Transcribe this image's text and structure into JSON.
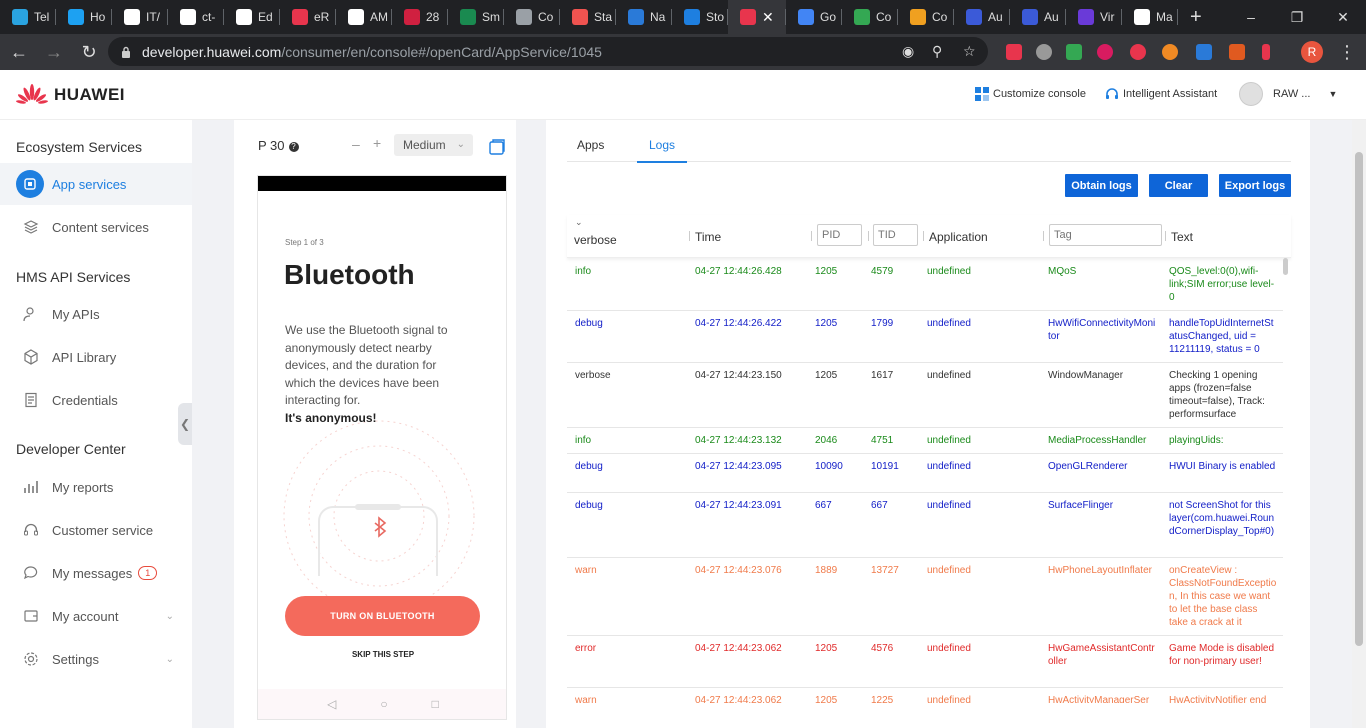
{
  "browser": {
    "tabs": [
      {
        "title": "Tel",
        "color": "#2aa3e0",
        "icon": "telegram-icon"
      },
      {
        "title": "Ho",
        "color": "#1da1f2",
        "icon": "twitter-icon"
      },
      {
        "title": "IT/",
        "color": "#ffffff",
        "icon": "github-icon"
      },
      {
        "title": "ct-",
        "color": "#ffffff",
        "icon": "github-icon"
      },
      {
        "title": "Ed",
        "color": "#ffffff",
        "icon": "github-icon"
      },
      {
        "title": "eR",
        "color": "#e8354d",
        "icon": "app-icon"
      },
      {
        "title": "AM",
        "color": "#ffffff",
        "icon": "globe-icon"
      },
      {
        "title": "28",
        "color": "#d02040",
        "icon": "app-icon"
      },
      {
        "title": "Sm",
        "color": "#1a8a50",
        "icon": "app-icon"
      },
      {
        "title": "Co",
        "color": "#9aa0a6",
        "icon": "globe-icon"
      },
      {
        "title": "Sta",
        "color": "#ef5350",
        "icon": "app-icon"
      },
      {
        "title": "Na",
        "color": "#2a7ad8",
        "icon": "code-icon"
      },
      {
        "title": "Sto",
        "color": "#1e7fe0",
        "icon": "app-icon"
      },
      {
        "title": "",
        "color": "#e8354d",
        "icon": "huawei-icon"
      },
      {
        "title": "Go",
        "color": "#4285f4",
        "icon": "translate-icon"
      },
      {
        "title": "Co",
        "color": "#34a853",
        "icon": "play-icon"
      },
      {
        "title": "Co",
        "color": "#f0a020",
        "icon": "app-icon"
      },
      {
        "title": "Au",
        "color": "#3b5ad8",
        "icon": "app-icon"
      },
      {
        "title": "Au",
        "color": "#3b5ad8",
        "icon": "app-icon"
      },
      {
        "title": "Vir",
        "color": "#6a3ad8",
        "icon": "app-icon"
      },
      {
        "title": "Ma",
        "color": "#ffffff",
        "icon": "github-icon"
      }
    ],
    "url_host": "developer.huawei.com",
    "url_path": "/consumer/en/console#/openCard/AppService/1045",
    "profile_initial": "R"
  },
  "header": {
    "logo_text": "HUAWEI",
    "customize": "Customize console",
    "assistant": "Intelligent Assistant",
    "user": "RAW ..."
  },
  "sidebar": {
    "section1": "Ecosystem Services",
    "app_services": "App services",
    "content_services": "Content services",
    "section2": "HMS API Services",
    "my_apis": "My APIs",
    "api_library": "API Library",
    "credentials": "Credentials",
    "section3": "Developer Center",
    "my_reports": "My reports",
    "customer_service": "Customer service",
    "my_messages": "My messages",
    "messages_count": "1",
    "my_account": "My account",
    "settings": "Settings"
  },
  "device": {
    "name": "P 30",
    "size": "Medium",
    "screen": {
      "step": "Step 1 of 3",
      "title": "Bluetooth",
      "description": "We use the Bluetooth signal to anonymously detect nearby devices, and the duration for which the devices have been interacting for.",
      "anonymous": "It's anonymous!",
      "button": "TURN ON BLUETOOTH",
      "skip": "SKIP THIS STEP"
    }
  },
  "logs": {
    "tabs": {
      "apps": "Apps",
      "logs": "Logs"
    },
    "buttons": {
      "obtain": "Obtain logs",
      "clear": "Clear",
      "export": "Export logs"
    },
    "filter_level": "verbose",
    "columns": {
      "time": "Time",
      "application": "Application",
      "text": "Text"
    },
    "placeholders": {
      "pid": "PID",
      "tid": "TID",
      "tag": "Tag"
    },
    "rows": [
      {
        "level": "info",
        "time": "04-27 12:44:26.428",
        "pid": "1205",
        "tid": "4579",
        "app": "undefined",
        "tag": "MQoS",
        "text": "QOS_level:0(0),wifi-link;SIM error;use level-0"
      },
      {
        "level": "debug",
        "time": "04-27 12:44:26.422",
        "pid": "1205",
        "tid": "1799",
        "app": "undefined",
        "tag": "HwWifiConnectivityMonitor",
        "text": "handleTopUidInternetStatusChanged, uid = 11211119, status = 0"
      },
      {
        "level": "verbose",
        "time": "04-27 12:44:23.150",
        "pid": "1205",
        "tid": "1617",
        "app": "undefined",
        "tag": "WindowManager",
        "text": "Checking 1 opening apps (frozen=false timeout=false), Track: performsurface"
      },
      {
        "level": "info",
        "time": "04-27 12:44:23.132",
        "pid": "2046",
        "tid": "4751",
        "app": "undefined",
        "tag": "MediaProcessHandler",
        "text": "playingUids:"
      },
      {
        "level": "debug",
        "time": "04-27 12:44:23.095",
        "pid": "10090",
        "tid": "10191",
        "app": "undefined",
        "tag": "OpenGLRenderer",
        "text": "HWUI Binary is enabled"
      },
      {
        "level": "debug",
        "time": "04-27 12:44:23.091",
        "pid": "667",
        "tid": "667",
        "app": "undefined",
        "tag": "SurfaceFlinger",
        "text": "not ScreenShot for this layer(com.huawei.RoundCornerDisplay_Top#0)"
      },
      {
        "level": "warn",
        "time": "04-27 12:44:23.076",
        "pid": "1889",
        "tid": "13727",
        "app": "undefined",
        "tag": "HwPhoneLayoutInflater",
        "text": "onCreateView : ClassNotFoundException, In this case we want to let the base class take a crack at it"
      },
      {
        "level": "error",
        "time": "04-27 12:44:23.062",
        "pid": "1205",
        "tid": "4576",
        "app": "undefined",
        "tag": "HwGameAssistantController",
        "text": "Game Mode is disabled for non-primary user!"
      },
      {
        "level": "warn",
        "time": "04-27 12:44:23.062",
        "pid": "1205",
        "tid": "1225",
        "app": "undefined",
        "tag": "HwActivityManagerSer",
        "text": "HwActivityNotifier end"
      }
    ]
  },
  "colors": {
    "accent": "#1e7fe0",
    "primary_button": "#0e65d8",
    "bt_button": "#f46a5c",
    "brand_red": "#e8354d"
  }
}
